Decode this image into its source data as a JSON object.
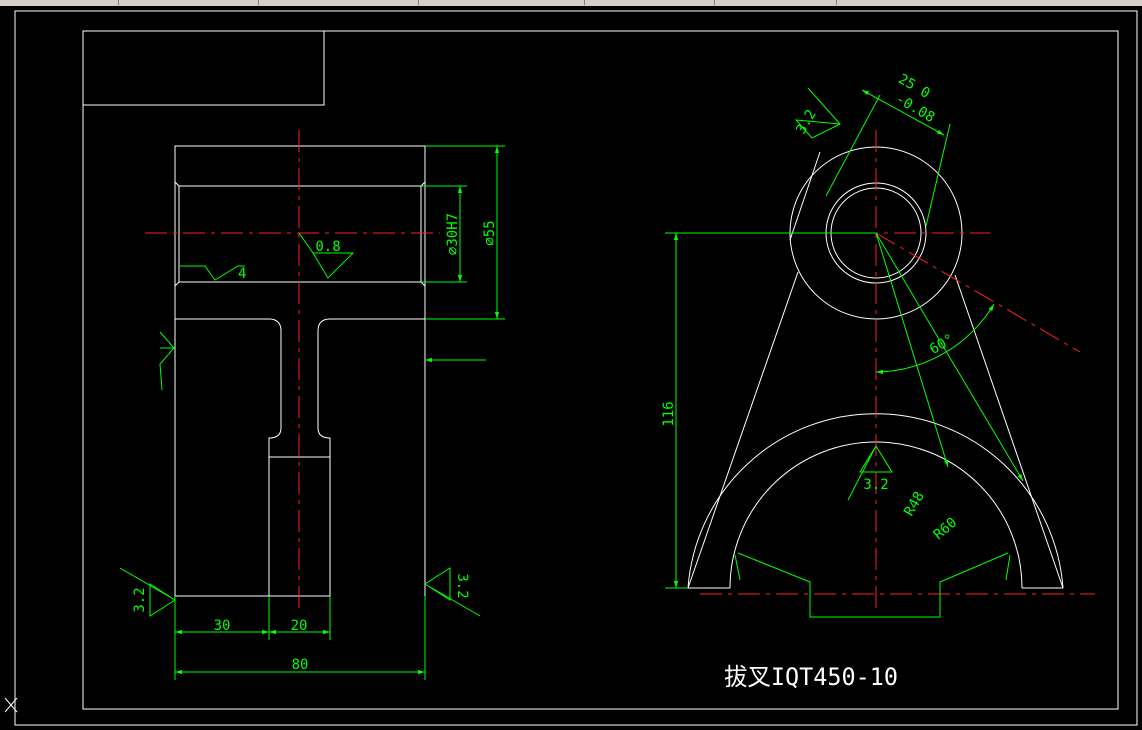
{
  "colors": {
    "background": "#000000",
    "geometry": "#ffffff",
    "centerline": "#ff2020",
    "dimension": "#00ff00",
    "toolbar": "#d4d0c8"
  },
  "icons": [
    "ucs-icon",
    "surface-finish-symbol-icon"
  ],
  "drawing": {
    "front_view": {
      "dims": {
        "d30": "30",
        "d20": "20",
        "d80": "80",
        "bore": "⌀30H7",
        "outer": "⌀55"
      },
      "finish": {
        "bore_top": "0.8",
        "bore_bottom": "4",
        "left": "3.2",
        "right": "3.2"
      }
    },
    "side_view": {
      "dims": {
        "tol_top": "25  0",
        "tol_bottom": "-0.08",
        "height": "116",
        "angle": "60°",
        "r_inner": "R48",
        "r_outer": "R60"
      },
      "finish": {
        "top": "3.2",
        "center": "3.2"
      }
    },
    "material_note": "拔叉IQT450-10"
  }
}
